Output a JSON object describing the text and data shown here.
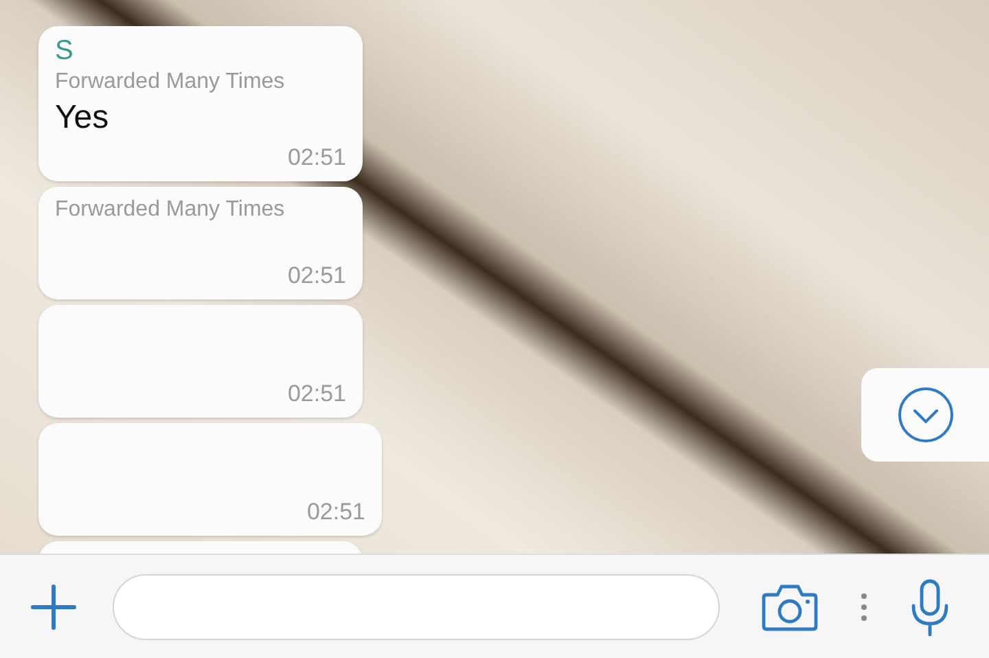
{
  "messages": [
    {
      "kind": "standard",
      "sender": "S",
      "forwarded_label": "Forwarded Many Times",
      "text": "Yes",
      "time": "02:51"
    },
    {
      "kind": "standard",
      "forwarded_label": "Forwarded Many Times",
      "time": "02:51"
    },
    {
      "kind": "standard",
      "time": "02:51"
    },
    {
      "kind": "wide",
      "time": "02:51"
    },
    {
      "kind": "standard"
    }
  ]
}
